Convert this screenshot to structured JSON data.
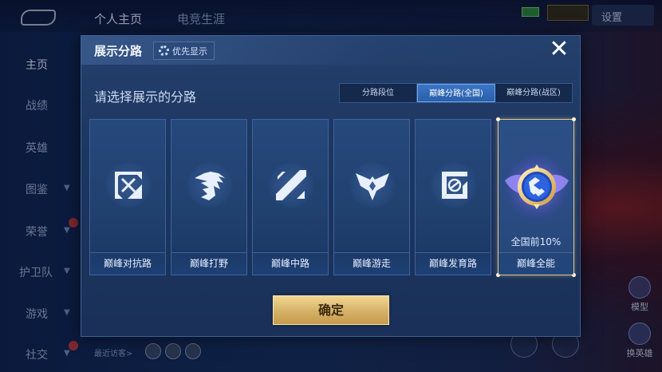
{
  "topbar": {
    "tabs": [
      {
        "label": "个人主页"
      },
      {
        "label": "电竞生涯"
      }
    ],
    "settings_label": "设置"
  },
  "sidebar": {
    "items": [
      {
        "label": "主页"
      },
      {
        "label": "战绩"
      },
      {
        "label": "英雄"
      },
      {
        "label": "图鉴"
      },
      {
        "label": "荣誉"
      },
      {
        "label": "护卫队"
      },
      {
        "label": "游戏"
      },
      {
        "label": "社交"
      }
    ],
    "recent_visitors": "最近访客>"
  },
  "right_side": {
    "model_label": "模型",
    "switch_hero_label": "换英雄"
  },
  "modal": {
    "title": "展示分路",
    "priority_label": "优先显示",
    "close_icon": "close-icon",
    "subtitle": "请选择展示的分路",
    "tabs": [
      {
        "label": "分路段位",
        "active": false
      },
      {
        "label": "巅峰分路(全国)",
        "active": true
      },
      {
        "label": "巅峰分路(战区)",
        "active": false
      }
    ],
    "cards": [
      {
        "label": "巅峰对抗路",
        "icon": "clash-lane-icon",
        "selected": false
      },
      {
        "label": "巅峰打野",
        "icon": "jungle-icon",
        "selected": false
      },
      {
        "label": "巅峰中路",
        "icon": "mid-lane-icon",
        "selected": false
      },
      {
        "label": "巅峰游走",
        "icon": "roam-icon",
        "selected": false
      },
      {
        "label": "巅峰发育路",
        "icon": "farm-lane-icon",
        "selected": false
      },
      {
        "label": "巅峰全能",
        "icon": "all-round-badge-icon",
        "selected": true,
        "rank": "全国前10%"
      }
    ],
    "confirm_label": "确定"
  },
  "colors": {
    "accent_gold": "#d7b46a",
    "active_tab_blue": "#3b76c6",
    "modal_bg": "#1d3660"
  }
}
